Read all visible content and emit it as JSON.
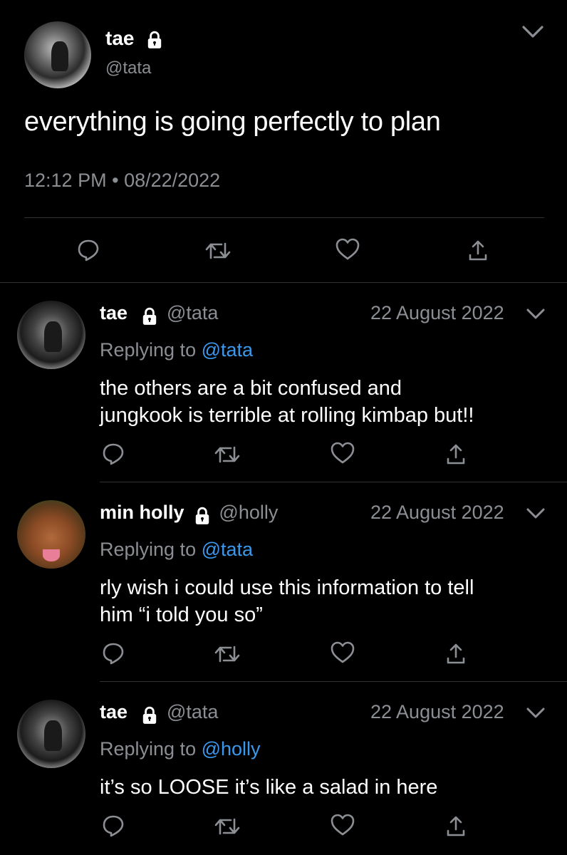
{
  "main_tweet": {
    "name": "tae",
    "handle": "@tata",
    "text": "everything is going perfectly to plan",
    "time": "12:12 PM",
    "separator": "•",
    "date": "08/22/2022"
  },
  "replies": [
    {
      "name": "tae",
      "handle": "@tata",
      "date": "22 August 2022",
      "replying_prefix": "Replying to",
      "replying_to": "@tata",
      "body_line1": "the others are a bit confused and",
      "body_line2": "jungkook is terrible at rolling kimbap but!!"
    },
    {
      "name": "min holly",
      "handle": "@holly",
      "date": "22 August 2022",
      "replying_prefix": "Replying to",
      "replying_to": "@tata",
      "body_line1": "rly wish i could use this information to tell",
      "body_line2": "him “i told you so”"
    },
    {
      "name": "tae",
      "handle": "@tata",
      "date": "22 August 2022",
      "replying_prefix": "Replying to",
      "replying_to": "@holly",
      "body_line1": "it’s so LOOSE it’s like a salad in here",
      "body_line2": ""
    }
  ],
  "colors": {
    "background": "#000000",
    "secondary_text": "#8b8e93",
    "link": "#3b98ec",
    "divider": "#2f3336"
  },
  "icons": [
    "lock-icon",
    "chevron-down-icon",
    "reply-icon",
    "retweet-icon",
    "like-icon",
    "share-icon"
  ]
}
